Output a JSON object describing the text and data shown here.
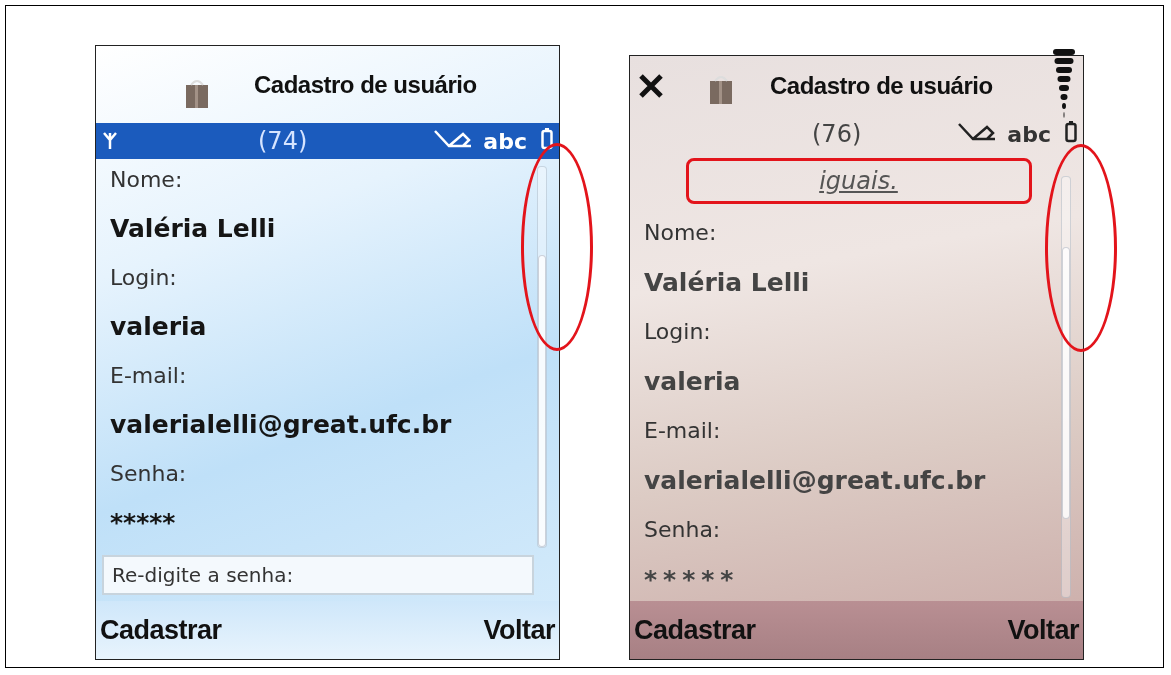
{
  "phones": [
    {
      "kind": "blue",
      "title": "Cadastro de usuário",
      "counter": "(74)",
      "input_mode": "abc",
      "close_button": false,
      "scrollbar_highlighted": true,
      "fields": [
        {
          "label": "Nome:",
          "value": "Valéria Lelli"
        },
        {
          "label": "Login:",
          "value": "valeria"
        },
        {
          "label": "E-mail:",
          "value": "valerialelli@great.ufc.br"
        },
        {
          "label": "Senha:",
          "value": "*****"
        }
      ],
      "next_field": {
        "label": "Re-digite a senha:"
      },
      "softkeys": {
        "left": "Cadastrar",
        "right": "Voltar"
      }
    },
    {
      "kind": "beige",
      "title": "Cadastro de usuário",
      "counter": "(76)",
      "input_mode": "abc",
      "close_button": true,
      "scrollbar_highlighted": true,
      "message": {
        "text": "iguais.",
        "highlighted": true
      },
      "fields": [
        {
          "label": "Nome:",
          "value": "Valéria Lelli"
        },
        {
          "label": "Login:",
          "value": "valeria"
        },
        {
          "label": "E-mail:",
          "value": "valerialelli@great.ufc.br"
        },
        {
          "label": "Senha:",
          "value": "*****"
        }
      ],
      "softkeys": {
        "left": "Cadastrar",
        "right": "Voltar"
      }
    }
  ]
}
